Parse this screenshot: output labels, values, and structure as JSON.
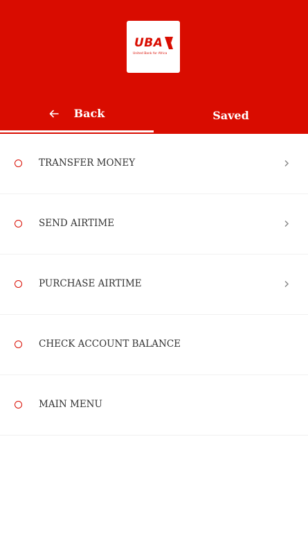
{
  "brand": {
    "logo_text": "UBA",
    "tagline": "United Bank for Africa",
    "color": "#d90c00"
  },
  "tabs": [
    {
      "label": "Back",
      "icon": "arrow-left-icon",
      "active": true
    },
    {
      "label": "Saved",
      "active": false
    }
  ],
  "menu": {
    "items": [
      {
        "label": "TRANSFER MONEY",
        "has_chevron": true
      },
      {
        "label": "SEND AIRTIME",
        "has_chevron": true
      },
      {
        "label": "PURCHASE AIRTIME",
        "has_chevron": true
      },
      {
        "label": "CHECK ACCOUNT BALANCE",
        "has_chevron": false
      },
      {
        "label": "MAIN MENU",
        "has_chevron": false
      }
    ]
  }
}
